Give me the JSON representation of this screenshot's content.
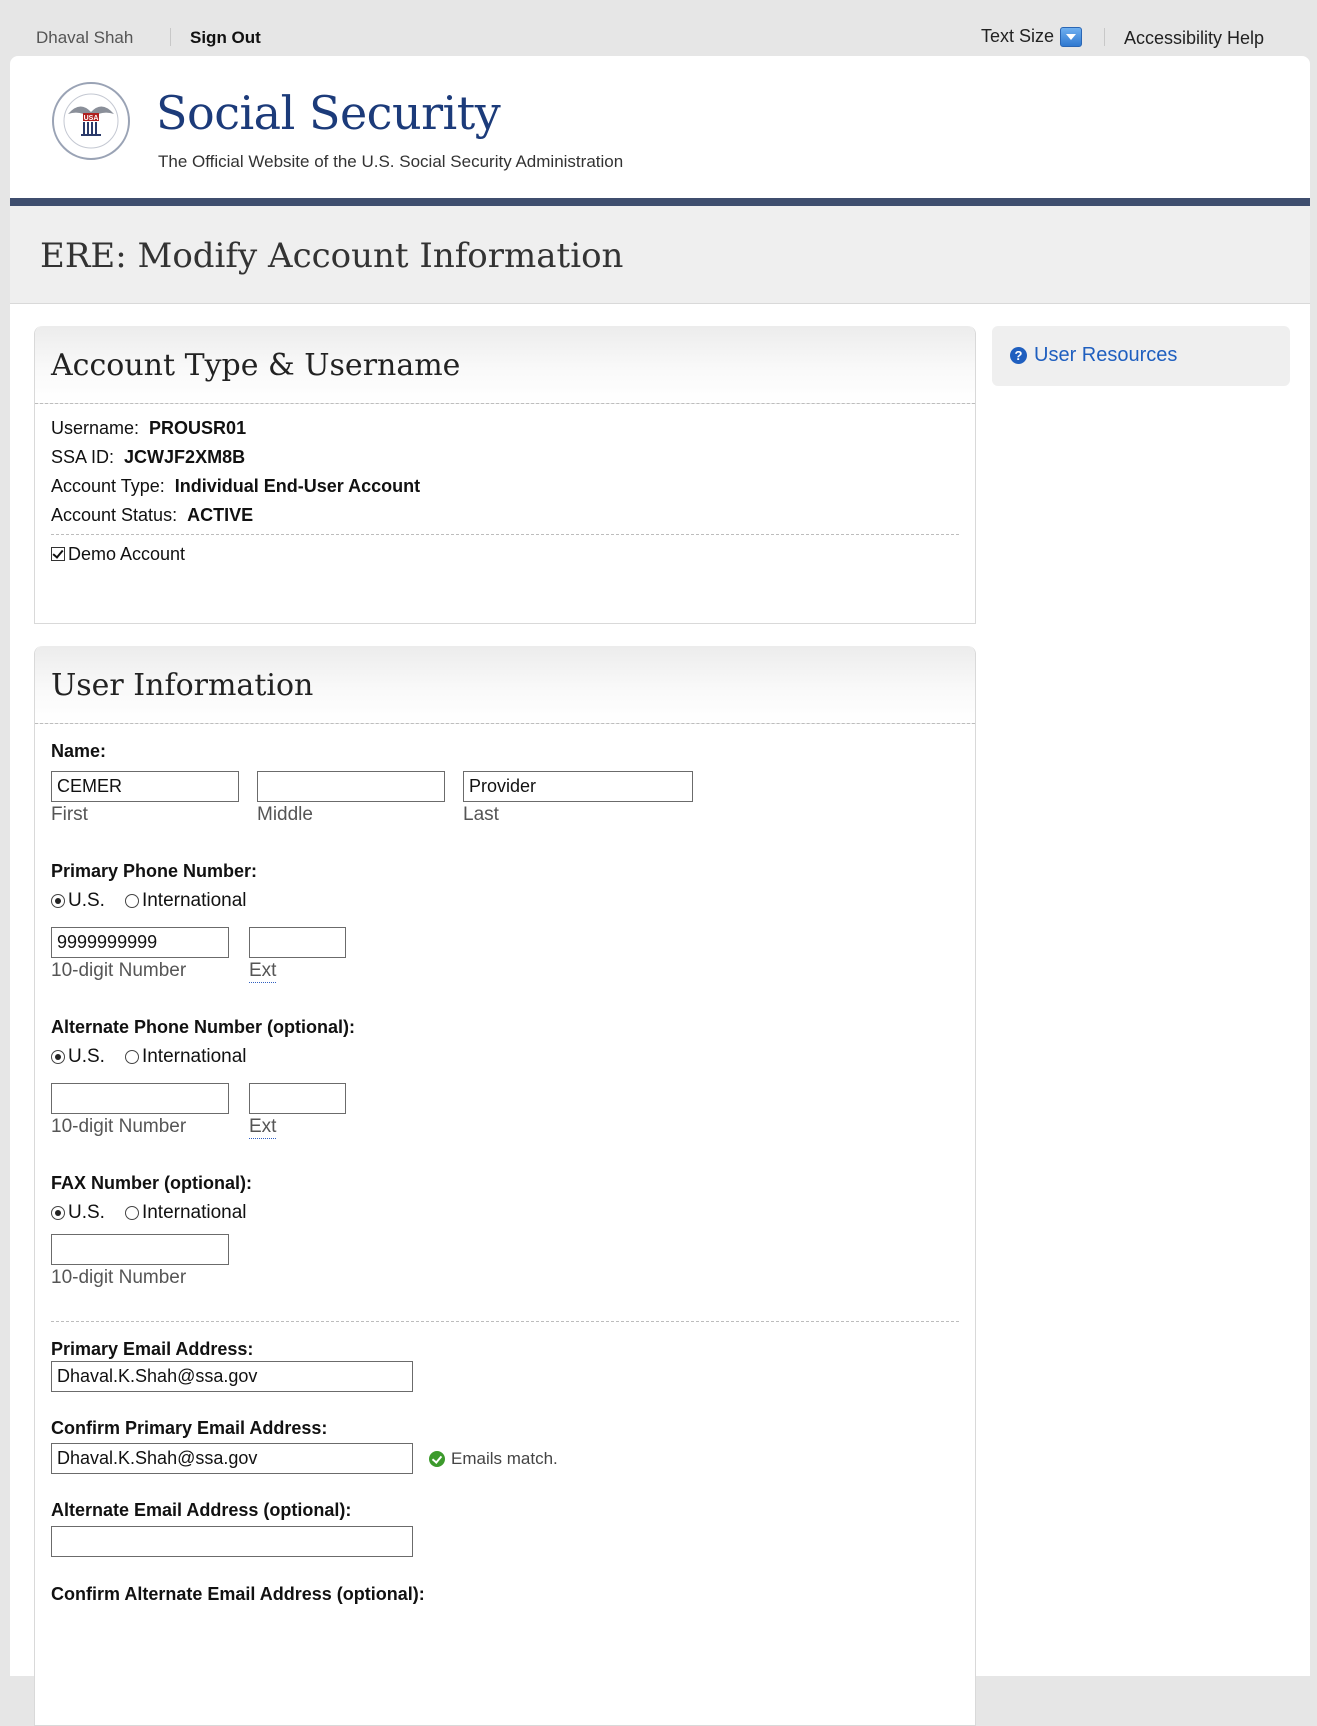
{
  "topbar": {
    "user_name": "Dhaval Shah",
    "sign_out": "Sign Out",
    "text_size": "Text Size",
    "accessibility_help": "Accessibility Help"
  },
  "header": {
    "title": "Social Security",
    "subtitle": "The Official Website of the U.S. Social Security Administration",
    "logo_icon": "ssa-seal-icon"
  },
  "page": {
    "title": "ERE: Modify Account Information"
  },
  "sidebar": {
    "user_resources": "User Resources",
    "icon": "question-circle-icon"
  },
  "account_panel": {
    "heading": "Account Type & Username",
    "username_label": "Username:",
    "username_value": "PROUSR01",
    "ssa_id_label": "SSA ID:",
    "ssa_id_value": "JCWJF2XM8B",
    "account_type_label": "Account Type:",
    "account_type_value": "Individual End-User Account",
    "account_status_label": "Account Status:",
    "account_status_value": "ACTIVE",
    "demo_account_label": "Demo Account",
    "demo_account_checked": true
  },
  "user_info": {
    "heading": "User Information",
    "name_label": "Name:",
    "first_value": "CEMER",
    "middle_value": "",
    "last_value": "Provider",
    "first_caption": "First",
    "middle_caption": "Middle",
    "last_caption": "Last",
    "primary_phone_label": "Primary Phone Number:",
    "us_label": "U.S.",
    "intl_label": "International",
    "primary_phone_value": "9999999999",
    "primary_ext_value": "",
    "number_caption": "10-digit Number",
    "ext_caption": "Ext",
    "alt_phone_label": "Alternate Phone Number (optional):",
    "alt_phone_value": "",
    "alt_ext_value": "",
    "fax_label": "FAX Number (optional):",
    "fax_value": "",
    "primary_email_label": "Primary Email Address:",
    "primary_email_value": "Dhaval.K.Shah@ssa.gov",
    "confirm_primary_email_label": "Confirm Primary Email Address:",
    "confirm_primary_email_value": "Dhaval.K.Shah@ssa.gov",
    "emails_match": "Emails match.",
    "alt_email_label": "Alternate Email Address (optional):",
    "alt_email_value": "",
    "confirm_alt_email_label": "Confirm Alternate Email Address (optional):"
  },
  "colors": {
    "brand_blue": "#1c3b7a",
    "rule": "#3f4e6e",
    "link": "#1f5fbf",
    "ok_green": "#3c9a2c"
  }
}
